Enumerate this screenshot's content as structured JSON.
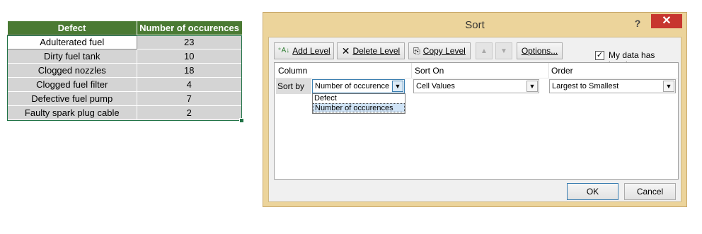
{
  "sheet": {
    "headers": [
      "Defect",
      "Number of occurences"
    ],
    "rows": [
      {
        "defect": "Adulterated fuel",
        "count": "23"
      },
      {
        "defect": "Dirty fuel tank",
        "count": "10"
      },
      {
        "defect": "Clogged nozzles",
        "count": "18"
      },
      {
        "defect": "Clogged fuel filter",
        "count": "4"
      },
      {
        "defect": "Defective fuel pump",
        "count": "7"
      },
      {
        "defect": "Faulty spark plug cable",
        "count": "2"
      }
    ]
  },
  "dialog": {
    "title": "Sort",
    "help": "?",
    "close": "✕",
    "toolbar": {
      "add_level": "Add Level",
      "delete_level": "Delete Level",
      "copy_level": "Copy Level",
      "move_up": "▲",
      "move_down": "▼",
      "options": "Options...",
      "headers_checkbox": "My data has headers",
      "headers_checked": "✓"
    },
    "grid": {
      "col_column": "Column",
      "col_sort_on": "Sort On",
      "col_order": "Order",
      "row_label": "Sort by",
      "column_value": "Number of occurence",
      "sort_on_value": "Cell Values",
      "order_value": "Largest to Smallest",
      "dropdown_options": [
        "Defect",
        "Number of occurences"
      ]
    },
    "ok": "OK",
    "cancel": "Cancel"
  }
}
